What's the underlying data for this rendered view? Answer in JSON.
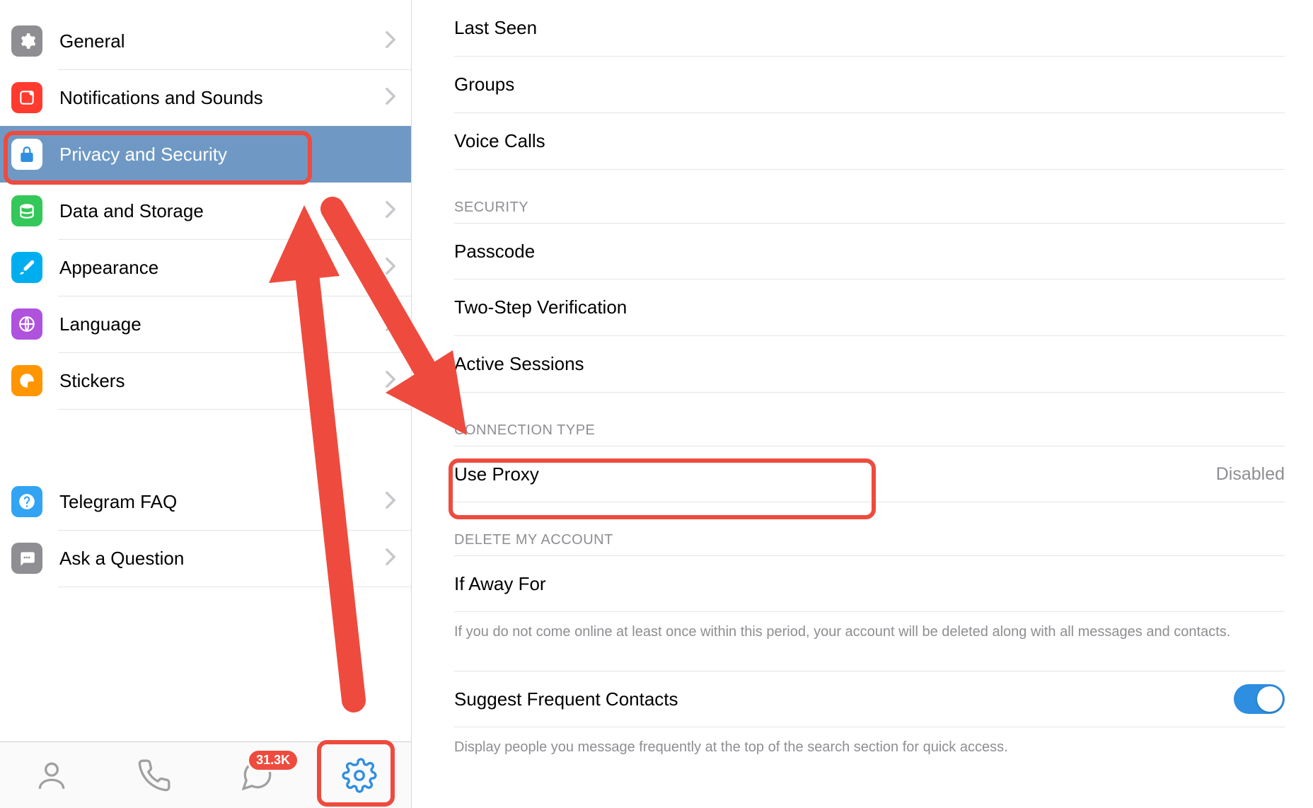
{
  "colors": {
    "accent": "#2e8ee0",
    "annotation": "#ee4b3e",
    "selected_bg": "#6f99c4"
  },
  "sidebar": {
    "items": [
      {
        "id": "general",
        "label": "General",
        "icon": "gear-icon",
        "icon_bg": "#8e8e93"
      },
      {
        "id": "notifications",
        "label": "Notifications and Sounds",
        "icon": "bell-square-icon",
        "icon_bg": "#ff3b30"
      },
      {
        "id": "privacy",
        "label": "Privacy and Security",
        "icon": "lock-icon",
        "icon_bg": "#ffffff",
        "icon_fg": "#2e8ee0",
        "selected": true
      },
      {
        "id": "data",
        "label": "Data and Storage",
        "icon": "stack-icon",
        "icon_bg": "#34c759"
      },
      {
        "id": "appearance",
        "label": "Appearance",
        "icon": "brush-icon",
        "icon_bg": "#00aeef"
      },
      {
        "id": "language",
        "label": "Language",
        "icon": "globe-icon",
        "icon_bg": "#af52de"
      },
      {
        "id": "stickers",
        "label": "Stickers",
        "icon": "sticker-icon",
        "icon_bg": "#ff9500"
      }
    ],
    "help_items": [
      {
        "id": "faq",
        "label": "Telegram FAQ",
        "icon": "question-icon",
        "icon_bg": "#32a4f3"
      },
      {
        "id": "ask",
        "label": "Ask a Question",
        "icon": "chat-dots-icon",
        "icon_bg": "#8e8e93"
      }
    ]
  },
  "tabbar": {
    "contacts": {
      "name": "contacts-tab"
    },
    "calls": {
      "name": "calls-tab"
    },
    "chats": {
      "name": "chats-tab",
      "badge": "31.3K"
    },
    "settings": {
      "name": "settings-tab",
      "active": true
    }
  },
  "detail": {
    "privacy_group": {
      "rows": [
        {
          "id": "last_seen",
          "label": "Last Seen"
        },
        {
          "id": "groups",
          "label": "Groups"
        },
        {
          "id": "voice_calls",
          "label": "Voice Calls"
        }
      ]
    },
    "security_group": {
      "header": "SECURITY",
      "rows": [
        {
          "id": "passcode",
          "label": "Passcode"
        },
        {
          "id": "two_step",
          "label": "Two-Step Verification"
        },
        {
          "id": "sessions",
          "label": "Active Sessions"
        }
      ]
    },
    "connection_group": {
      "header": "CONNECTION TYPE",
      "rows": [
        {
          "id": "use_proxy",
          "label": "Use Proxy",
          "value": "Disabled"
        }
      ]
    },
    "delete_group": {
      "header": "DELETE MY ACCOUNT",
      "rows": [
        {
          "id": "if_away",
          "label": "If Away For"
        }
      ],
      "footer": "If you do not come online at least once within this period, your account will be deleted along with all messages and contacts."
    },
    "suggest_group": {
      "rows": [
        {
          "id": "suggest",
          "label": "Suggest Frequent Contacts",
          "toggle": true
        }
      ],
      "footer": "Display people you message frequently at the top of the search section for quick access."
    }
  }
}
